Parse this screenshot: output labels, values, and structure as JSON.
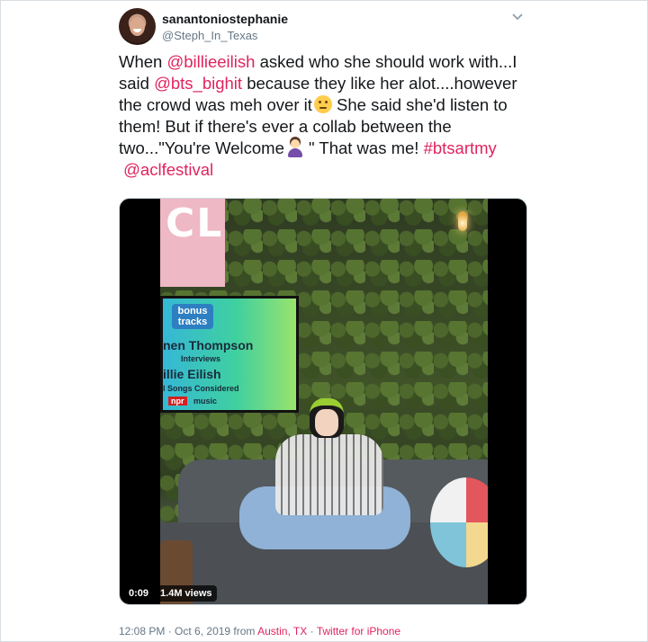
{
  "user": {
    "display_name": "sanantoniostephanie",
    "handle": "@Steph_In_Texas"
  },
  "tweet": {
    "p1": "When ",
    "m1": "@billieeilish",
    "p2": " asked who she should work with...I said ",
    "m2": "@bts_bighit",
    "p3": " because they like her alot....however the crowd was meh over it",
    "p4": " She said she'd listen to them! But if there's ever a collab between the two...\"You're Welcome",
    "p5": " \" That was me! ",
    "hashtag": "#btsartmy",
    "m3": "@aclfestival",
    "emoji_1": "face-with-rolling-eyes",
    "emoji_2": "person-tipping-hand"
  },
  "video": {
    "sign_text": "CL",
    "monitor": {
      "bonus": "bonus tracks",
      "line1": "nen Thompson",
      "line2": "Interviews",
      "line3": "illie Eilish",
      "line4": "l Songs Considered",
      "npr": "npr",
      "npr_music": "music"
    },
    "duration": "0:09",
    "views": "1.4M views"
  },
  "meta": {
    "time": "12:08 PM",
    "sep1": " · ",
    "date": "Oct 6, 2019",
    "from": " from ",
    "location": "Austin, TX",
    "sep2": " · ",
    "client": "Twitter for iPhone"
  },
  "colors": {
    "accent": "#e0245e",
    "text": "#14171a",
    "muted": "#657786"
  }
}
